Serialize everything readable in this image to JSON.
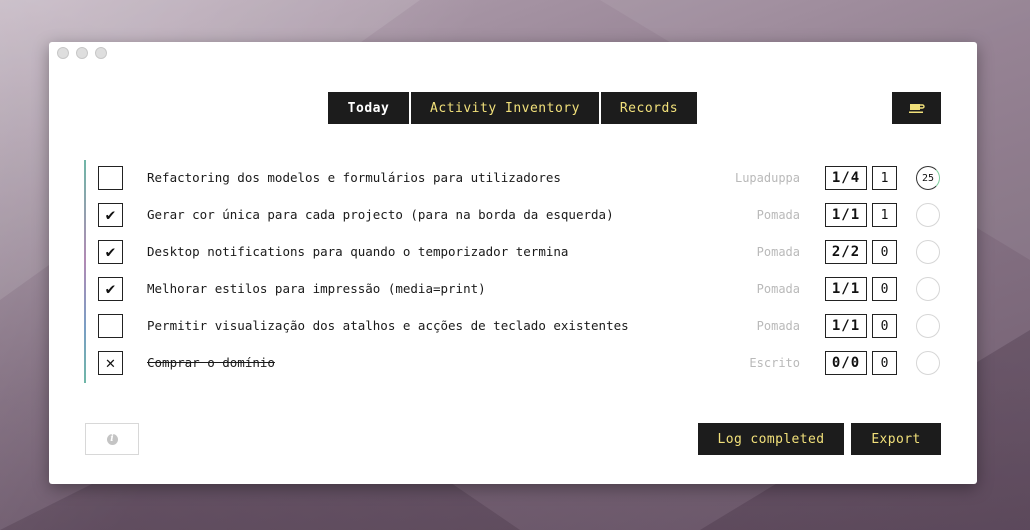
{
  "tabs": [
    {
      "label": "Today",
      "active": true
    },
    {
      "label": "Activity Inventory",
      "active": false
    },
    {
      "label": "Records",
      "active": false
    }
  ],
  "toolbar": {
    "break_icon": "coffee-cup-icon"
  },
  "tasks": [
    {
      "checked": "",
      "title": "Refactoring dos modelos e formulários para utilizadores",
      "project": "Lupaduppa",
      "count": "1/4",
      "extra": "1",
      "timer": "25",
      "struck": false
    },
    {
      "checked": "✔",
      "title": "Gerar cor única para cada projecto (para na borda da esquerda)",
      "project": "Pomada",
      "count": "1/1",
      "extra": "1",
      "timer": "",
      "struck": false
    },
    {
      "checked": "✔",
      "title": "Desktop notifications para quando o temporizador termina",
      "project": "Pomada",
      "count": "2/2",
      "extra": "0",
      "timer": "",
      "struck": false
    },
    {
      "checked": "✔",
      "title": "Melhorar estilos para impressão (media=print)",
      "project": "Pomada",
      "count": "1/1",
      "extra": "0",
      "timer": "",
      "struck": false
    },
    {
      "checked": "",
      "title": "Permitir visualização dos atalhos e acções de teclado existentes",
      "project": "Pomada",
      "count": "1/1",
      "extra": "0",
      "timer": "",
      "struck": false
    },
    {
      "checked": "✕",
      "title": "Comprar o domínio",
      "project": "Escrito",
      "count": "0/0",
      "extra": "0",
      "timer": "",
      "struck": true
    }
  ],
  "footer": {
    "info_icon": "info-icon",
    "info_glyph": "i",
    "log_label": "Log completed",
    "export_label": "Export"
  },
  "colors": {
    "button_bg": "#1c1c1c",
    "button_text": "#f1e07a",
    "active_tab_text": "#ffffff",
    "project_text": "#b9b9b9"
  }
}
